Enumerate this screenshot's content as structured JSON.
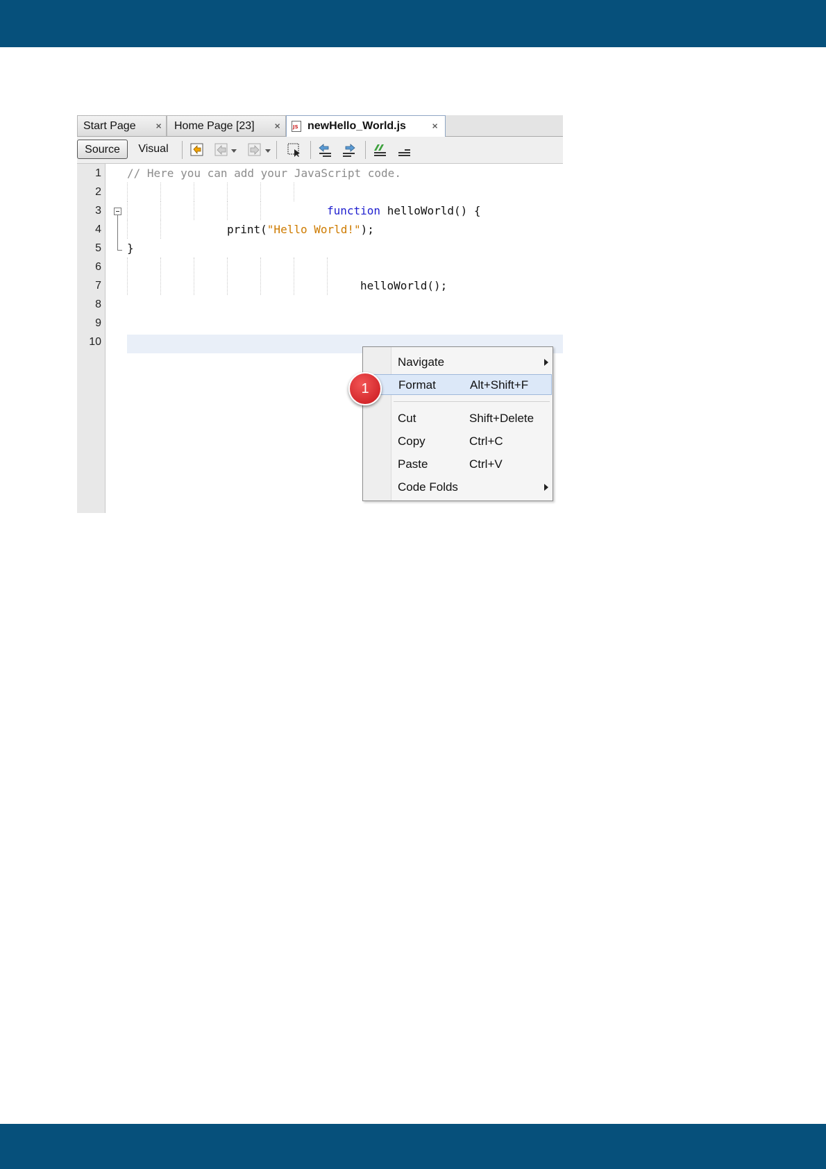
{
  "tabs": [
    {
      "label": "Start Page",
      "close": "⨯"
    },
    {
      "label": "Home Page [23]",
      "close": "⨯"
    },
    {
      "label": "newHello_World.js",
      "close": "⨯",
      "icon": "js-file-icon",
      "active": true
    }
  ],
  "toolbar": {
    "source_label": "Source",
    "visual_label": "Visual"
  },
  "line_numbers": [
    "1",
    "2",
    "3",
    "4",
    "5",
    "6",
    "7",
    "8",
    "9",
    "10"
  ],
  "code": {
    "line1": "// Here you can add your JavaScript code.",
    "line3_kw": "function",
    "line3_rest": " helloWorld() {",
    "line4_a": "print(",
    "line4_str": "\"Hello World!\"",
    "line4_b": ");",
    "line5": "}",
    "line7": "helloWorld();"
  },
  "context_menu": {
    "items": [
      {
        "label": "Navigate",
        "shortcut": "",
        "submenu": true
      },
      {
        "label": "Format",
        "shortcut": "Alt+Shift+F",
        "highlighted": true
      },
      {
        "label": "Cut",
        "shortcut": "Shift+Delete"
      },
      {
        "label": "Copy",
        "shortcut": "Ctrl+C"
      },
      {
        "label": "Paste",
        "shortcut": "Ctrl+V"
      },
      {
        "label": "Code Folds",
        "shortcut": "",
        "submenu": true
      }
    ]
  },
  "callout": {
    "number": "1"
  },
  "colors": {
    "band": "#06507b",
    "keyword": "#1f1fcf",
    "string": "#ce7b00",
    "comment": "#8c8c8c",
    "callout": "#d42026"
  }
}
